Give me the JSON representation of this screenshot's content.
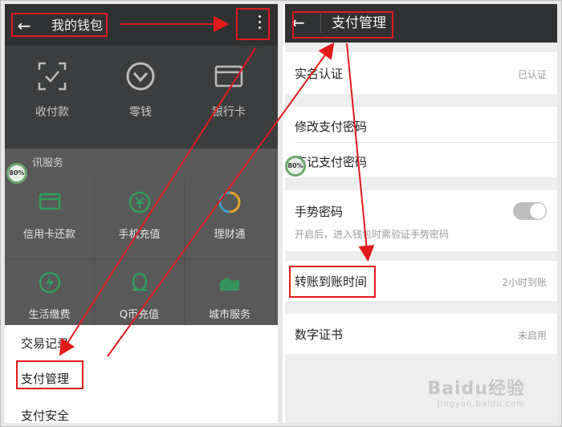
{
  "left": {
    "title": "我的钱包",
    "back_icon": "arrow-left-icon",
    "more_icon": "more-vertical-icon",
    "wallet_tiles": [
      {
        "label": "收付款",
        "icon": "scan-icon"
      },
      {
        "label": "零钱",
        "icon": "coin-icon"
      },
      {
        "label": "银行卡",
        "icon": "card-icon"
      }
    ],
    "service_header": "讯服务",
    "badge": "80%",
    "services": [
      {
        "label": "信用卡还款",
        "icon": "credit-card-icon"
      },
      {
        "label": "手机充值",
        "icon": "phone-recharge-icon"
      },
      {
        "label": "理财通",
        "icon": "finance-icon"
      },
      {
        "label": "生活缴费",
        "icon": "bolt-icon"
      },
      {
        "label": "Q币充值",
        "icon": "penguin-icon"
      },
      {
        "label": "城市服务",
        "icon": "city-icon"
      }
    ],
    "menu": [
      {
        "label": "交易记录"
      },
      {
        "label": "支付管理"
      },
      {
        "label": "支付安全"
      }
    ]
  },
  "right": {
    "title": "支付管理",
    "back_icon": "arrow-left-icon",
    "badge": "80%",
    "realname": {
      "label": "实名认证",
      "value": "已认证"
    },
    "modify_pwd": {
      "label": "修改支付密码"
    },
    "forget_pwd": {
      "label": "忘记支付密码"
    },
    "gesture": {
      "label": "手势密码",
      "desc": "开启后，进入钱包时需验证手势密码",
      "enabled": false
    },
    "transfer": {
      "label": "转账到账时间",
      "value": "2小时到账"
    },
    "cert": {
      "label": "数字证书",
      "value": "未启用"
    }
  },
  "watermark": {
    "text": "Baidu经验",
    "sub": "jingyan.baidu.com"
  },
  "colors": {
    "annotation": "#e21b1b",
    "toolbar": "#2f3132",
    "accent_green": "#2f9f5b"
  }
}
